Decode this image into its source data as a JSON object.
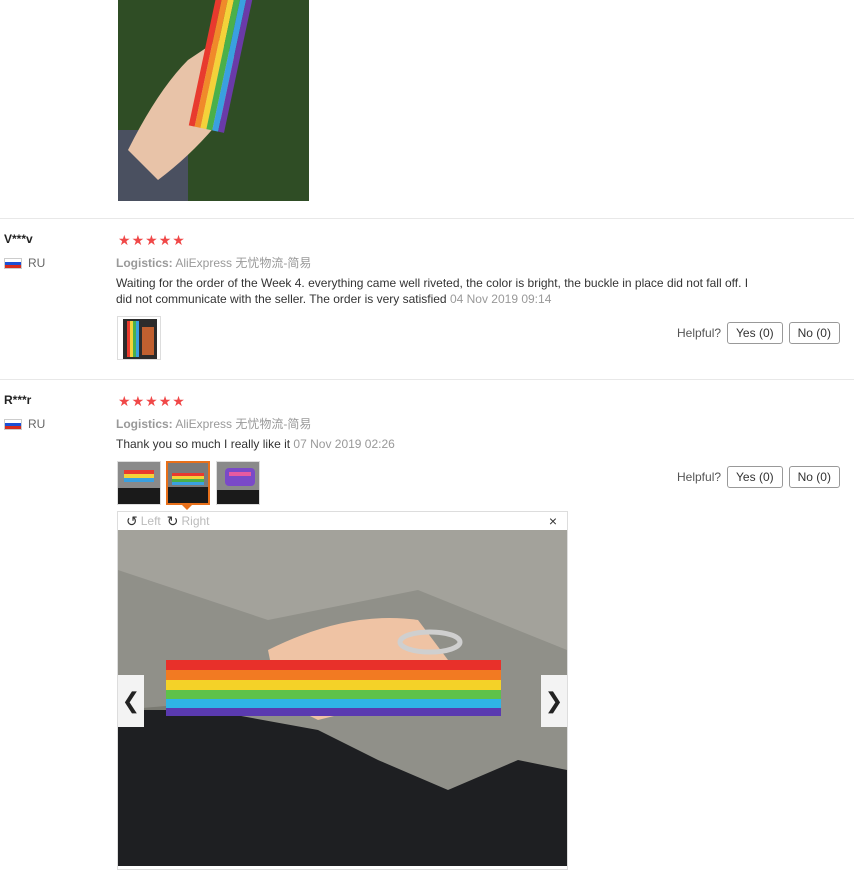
{
  "reviews": [
    {
      "name": "V***v",
      "country": "RU",
      "stars": 5,
      "logistics_label": "Logistics:",
      "logistics_value": "AliExpress 无忧物流-简易",
      "text": "Waiting for the order of the Week 4. everything came well riveted, the color is bright, the buckle in place did not fall off. I did not communicate with the seller. The order is very satisfied",
      "date": "04 Nov 2019 09:14"
    },
    {
      "name": "R***r",
      "country": "RU",
      "stars": 5,
      "logistics_label": "Logistics:",
      "logistics_value": "AliExpress 无忧物流-简易",
      "text": "Thank you so much I really like it",
      "date": "07 Nov 2019 02:26"
    }
  ],
  "helpful": {
    "label": "Helpful?",
    "yes": "Yes (0)",
    "no": "No (0)"
  },
  "viewer": {
    "left": "Left",
    "right": "Right",
    "close": "×"
  },
  "icons": {
    "star": "star-icon",
    "flag": "russia-flag-icon",
    "rotate_left": "rotate-left-icon",
    "rotate_right": "rotate-right-icon",
    "prev": "chevron-left-icon",
    "next": "chevron-right-icon"
  },
  "colors": {
    "star": "#f04848",
    "selected_thumb": "#e8701a"
  }
}
